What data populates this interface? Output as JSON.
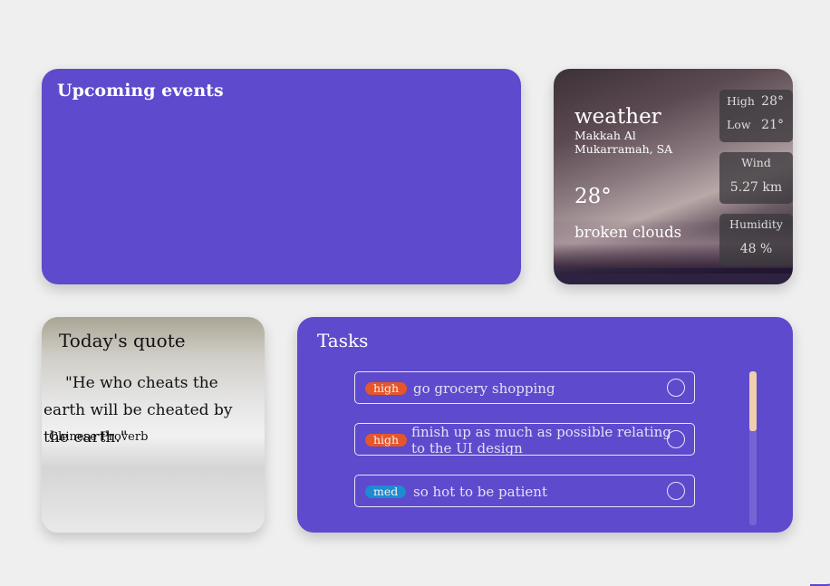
{
  "events": {
    "title": "Upcoming events"
  },
  "weather": {
    "title": "weather",
    "location": "Makkah Al Mukarramah, SA",
    "temperature": "28°",
    "description": "broken clouds",
    "high_label": "High",
    "high_value": "28°",
    "low_label": "Low",
    "low_value": "21°",
    "wind_label": "Wind",
    "wind_value": "5.27 km",
    "humidity_label": "Humidity",
    "humidity_value": "48 %"
  },
  "quote": {
    "title": "Today's quote",
    "text": "\"He who cheats the earth will be cheated by the earth.\"",
    "author": "Chinese Proverb"
  },
  "tasks": {
    "title": "Tasks",
    "items": [
      {
        "priority": "high",
        "text": "go grocery shopping"
      },
      {
        "priority": "high",
        "text": "finish up as much as possible relating to the UI design"
      },
      {
        "priority": "med",
        "text": "so hot to be patient"
      }
    ],
    "scroll_position": 0
  },
  "colors": {
    "card_purple": "#5e4acc",
    "priority_high": "#e5562a",
    "priority_med": "#1e8ad0",
    "scroll_thumb": "#efcfae"
  }
}
